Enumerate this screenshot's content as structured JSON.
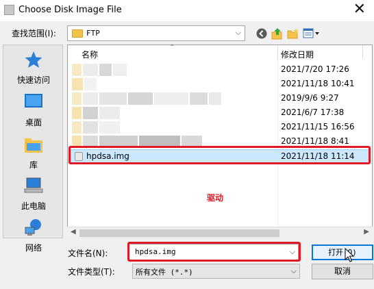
{
  "window": {
    "title": "Choose Disk Image File",
    "close_glyph": "✕"
  },
  "lookin": {
    "label": "查找范围(I):",
    "value": "FTP"
  },
  "places": [
    {
      "label": "快速访问",
      "icon": "star-icon"
    },
    {
      "label": "桌面",
      "icon": "desktop-icon"
    },
    {
      "label": "库",
      "icon": "library-icon"
    },
    {
      "label": "此电脑",
      "icon": "computer-icon"
    },
    {
      "label": "网络",
      "icon": "network-icon"
    }
  ],
  "file_list": {
    "col_name": "名称",
    "col_date": "修改日期",
    "rows": [
      {
        "date": "2021/7/20 17:26"
      },
      {
        "date": "2021/11/18 10:41"
      },
      {
        "date": "2019/9/6 9:27"
      },
      {
        "date": "2021/6/7 17:38"
      },
      {
        "date": "2021/11/15 16:56"
      },
      {
        "date": "2021/11/18 8:41"
      }
    ],
    "selected": {
      "name": "hpdsa.img",
      "date": "2021/11/18 11:14"
    }
  },
  "annotation": "驱动",
  "filename": {
    "label": "文件名(N):",
    "value": "hpdsa.img"
  },
  "filetype": {
    "label": "文件类型(T):",
    "value": "所有文件 (*.*)"
  },
  "buttons": {
    "open": "打开(O)",
    "cancel": "取消"
  },
  "colors": {
    "accent": "#0078d7",
    "highlight": "#e01a24",
    "selection": "#cce8ff"
  }
}
